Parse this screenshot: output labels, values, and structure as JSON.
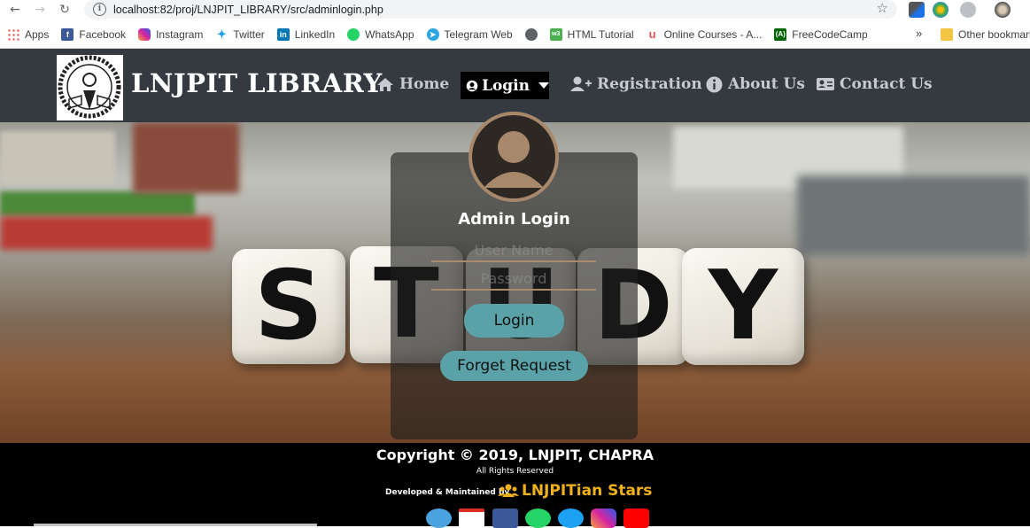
{
  "browser": {
    "url": "localhost:82/proj/LNJPIT_LIBRARY/src/adminlogin.php",
    "bookmarks": [
      "Apps",
      "Facebook",
      "Instagram",
      "Twitter",
      "LinkedIn",
      "WhatsApp",
      "Telegram Web",
      "",
      "HTML Tutorial",
      "Online Courses - A...",
      "FreeCodeCamp"
    ],
    "overflow": "»",
    "other_bookmarks": "Other bookmark"
  },
  "header": {
    "brand": "LNJPIT LIBRARY",
    "nav": {
      "home": "Home",
      "login": "Login",
      "registration": "Registration",
      "about": "About Us",
      "contact": "Contact Us"
    }
  },
  "hero": {
    "dice_letters": [
      "S",
      "T",
      "U",
      "D",
      "Y"
    ]
  },
  "login_form": {
    "title": "Admin Login",
    "username_placeholder": "User Name",
    "password_placeholder": "Password",
    "login_button": "Login",
    "forget_button": "Forget Request"
  },
  "footer": {
    "copyright": "Copyright © 2019, LNJPIT, CHAPRA",
    "rights": "All Rights Reserved",
    "developed_by": "Developed & Maintained by",
    "team": "LNJPITian Stars",
    "social": [
      "website-icon",
      "gmail-icon",
      "facebook-icon",
      "whatsapp-icon",
      "twitter-icon",
      "instagram-icon",
      "youtube-icon"
    ]
  },
  "colors": {
    "navbar": "#343a40",
    "accent_button": "#5ba2a8",
    "team_name": "#f0b21a",
    "field_underline": "#a88c6c"
  }
}
